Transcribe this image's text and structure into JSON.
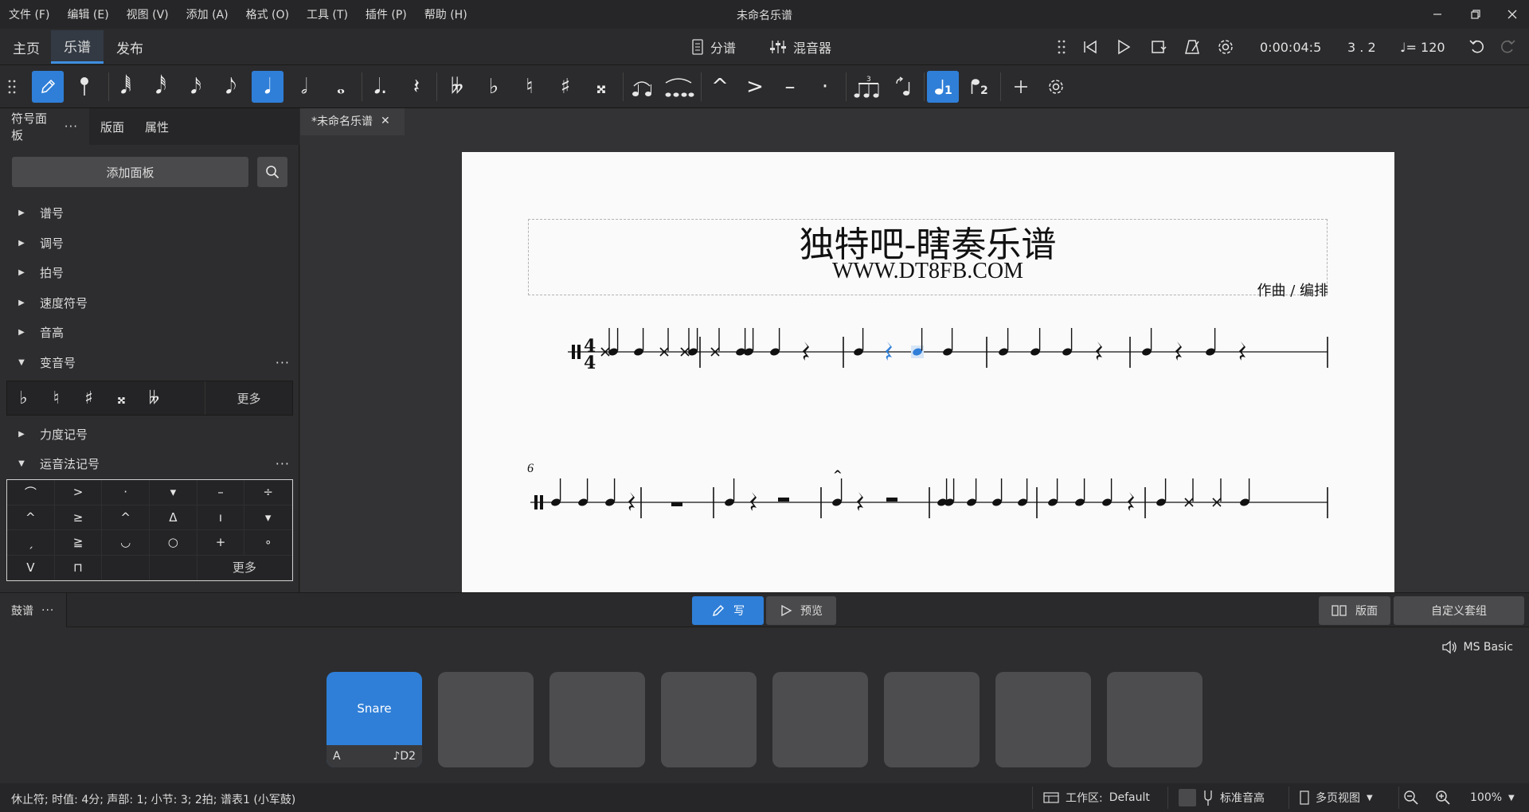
{
  "menubar": {
    "items": [
      "文件 (F)",
      "编辑 (E)",
      "视图 (V)",
      "添加 (A)",
      "格式 (O)",
      "工具 (T)",
      "插件 (P)",
      "帮助 (H)"
    ],
    "window_title": "未命名乐谱"
  },
  "workspace_tabs": [
    "主页",
    "乐谱",
    "发布"
  ],
  "top_center": {
    "parts_label": "分谱",
    "mixer_label": "混音器"
  },
  "playback": {
    "time": "0:00:04:5",
    "position": "3 . 2",
    "tempo_value": "= 120"
  },
  "left_panel": {
    "tabs": [
      "符号面板",
      "版面",
      "属性"
    ],
    "add_palette_label": "添加面板",
    "palettes": [
      "谱号",
      "调号",
      "拍号",
      "速度符号",
      "音高",
      "变音号",
      "力度记号",
      "运音法记号"
    ],
    "accidentals": [
      "♭",
      "♮",
      "♯",
      "𝄪",
      "𝄫"
    ],
    "more_label": "更多",
    "articulations": [
      "⌒",
      ">",
      "·",
      "▾",
      "–",
      "÷",
      "^",
      "≥",
      "^",
      "Δ",
      "ı",
      "▾",
      "ˏ",
      "≧",
      "◡",
      "○",
      "+",
      "∘",
      "V",
      "⊓"
    ]
  },
  "document": {
    "tab_label": "*未命名乐谱",
    "title": "独特吧-瞎奏乐谱",
    "subtitle": "WWW.DT8FB.COM",
    "composer": "作曲 / 编排",
    "measure_number": "6"
  },
  "bottom_bar": {
    "drum_label": "鼓谱",
    "write_label": "写",
    "preview_label": "预览",
    "layout_label": "版面",
    "custom_kit_label": "自定义套组"
  },
  "pads": {
    "sound_label": "MS Basic",
    "pad1_name": "Snare",
    "pad1_shortcut": "A",
    "pad1_pitch": "D2"
  },
  "status_bar": {
    "info": "休止符; 时值: 4分; 声部: 1; 小节: 3; 2拍; 谱表1 (小军鼓)",
    "workspace_label": "工作区:",
    "workspace_value": "Default",
    "concert_pitch_label": "标准音高",
    "view_mode_label": "多页视图",
    "zoom_value": "100%"
  },
  "colors": {
    "accent": "#2f7fd8",
    "background": "#2b2b2d",
    "page": "#fafafa"
  }
}
